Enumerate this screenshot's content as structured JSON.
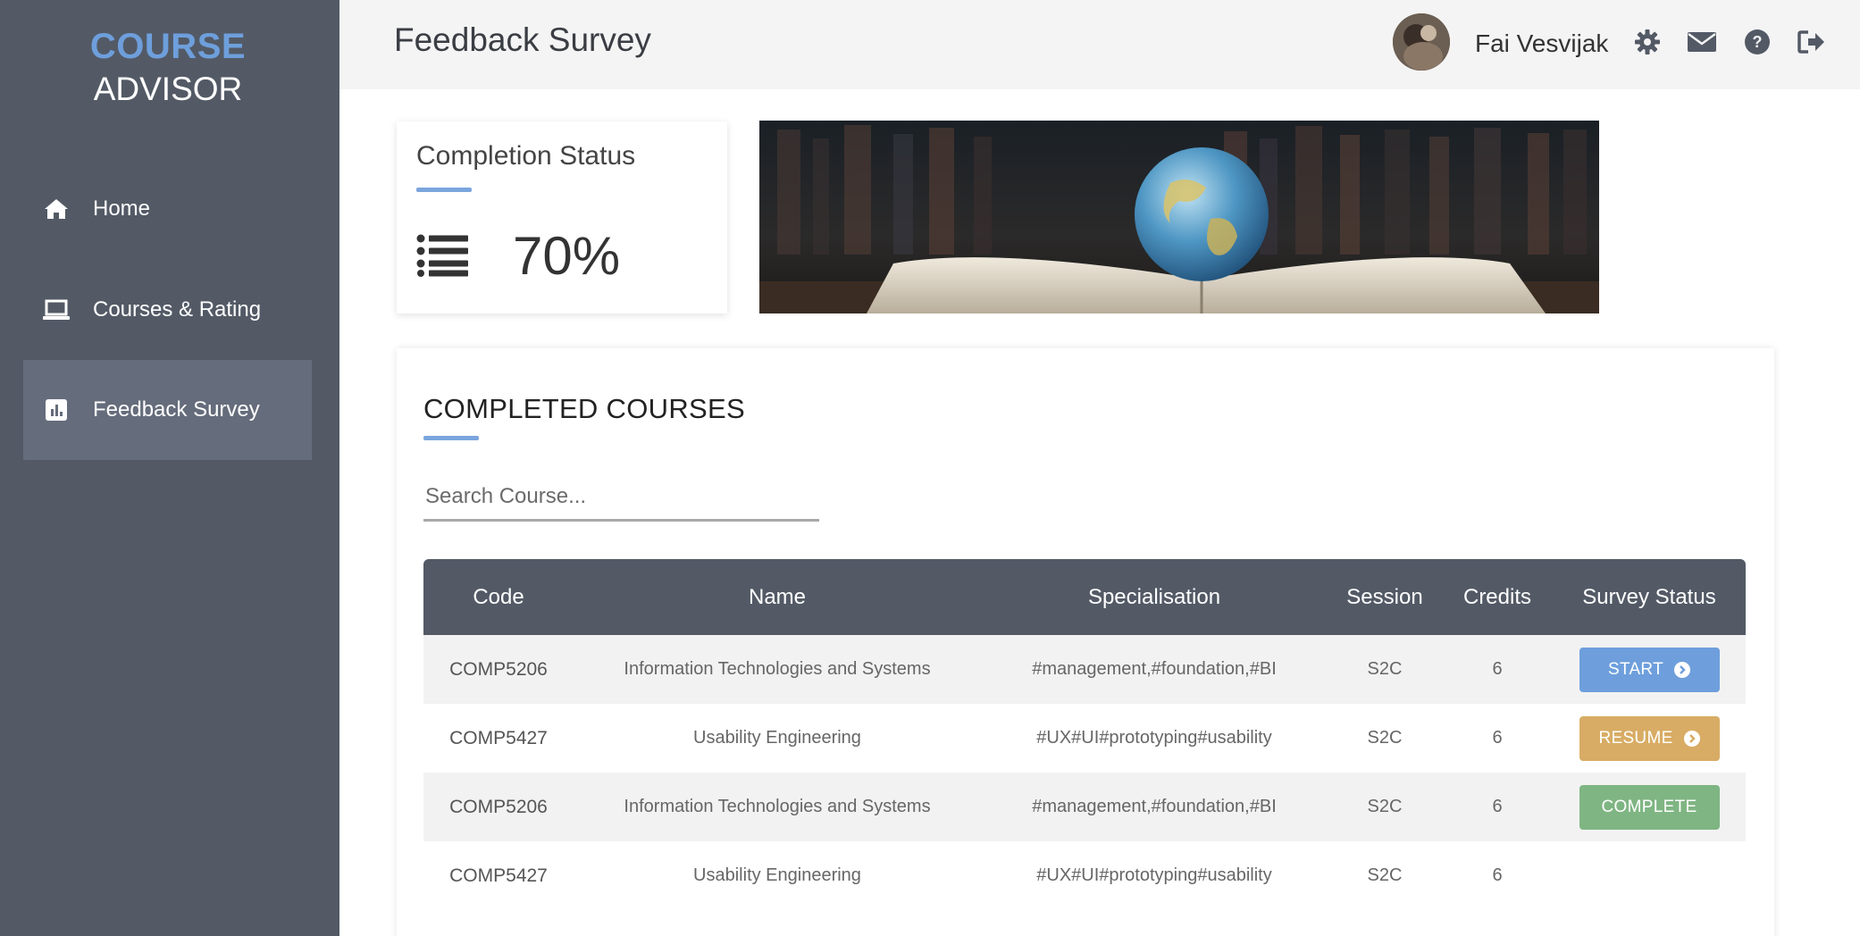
{
  "app": {
    "logo_line1": "COURSE",
    "logo_line2": "ADVISOR"
  },
  "sidebar": {
    "items": [
      {
        "label": "Home",
        "icon": "home-icon",
        "active": false
      },
      {
        "label": "Courses & Rating",
        "icon": "laptop-icon",
        "active": false
      },
      {
        "label": "Feedback Survey",
        "icon": "chart-icon",
        "active": true
      }
    ]
  },
  "header": {
    "title": "Feedback Survey",
    "user_name": "Fai Vesvijak",
    "icons": [
      "gear-icon",
      "envelope-icon",
      "help-icon",
      "logout-icon"
    ]
  },
  "completion": {
    "title": "Completion Status",
    "percent_text": "70%",
    "icon": "list-icon"
  },
  "courses": {
    "title": "COMPLETED COURSES",
    "search_placeholder": "Search Course...",
    "columns": [
      "Code",
      "Name",
      "Specialisation",
      "Session",
      "Credits",
      "Survey Status"
    ],
    "rows": [
      {
        "code": "COMP5206",
        "name": "Information Technologies and Systems",
        "spec": "#management,#foundation,#BI",
        "session": "S2C",
        "credits": "6",
        "status": "START",
        "status_color": "#6e9fdc",
        "has_arrow": true
      },
      {
        "code": "COMP5427",
        "name": "Usability Engineering",
        "spec": "#UX#UI#prototyping#usability",
        "session": "S2C",
        "credits": "6",
        "status": "RESUME",
        "status_color": "#d8ac64",
        "has_arrow": true
      },
      {
        "code": "COMP5206",
        "name": "Information Technologies and Systems",
        "spec": "#management,#foundation,#BI",
        "session": "S2C",
        "credits": "6",
        "status": "COMPLETE",
        "status_color": "#7fb583",
        "has_arrow": false
      },
      {
        "code": "COMP5427",
        "name": "Usability Engineering",
        "spec": "#UX#UI#prototyping#usability",
        "session": "S2C",
        "credits": "6",
        "status": "",
        "status_color": "",
        "has_arrow": false
      }
    ]
  }
}
